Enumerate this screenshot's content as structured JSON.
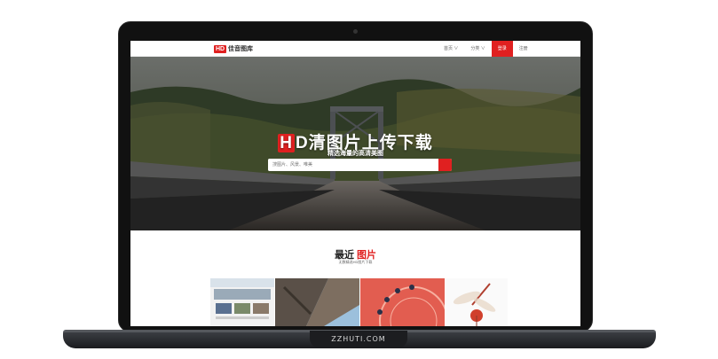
{
  "site": {
    "logo_mark": "HD",
    "logo_text": "佳音图库",
    "nav": [
      "首页 ∨",
      "分类 ∨",
      "登录",
      "注册"
    ]
  },
  "hero": {
    "title_mark": "H",
    "title_rest": "D清图片上传下载",
    "subtitle": "精选海量的高清美图",
    "search_placeholder": "搜图片、风景、唯美"
  },
  "recent": {
    "title_plain": "最近",
    "title_accent": "图片",
    "subtitle": "无数精选HD图片下载"
  },
  "watermark": "ZZHUTI.COM",
  "colors": {
    "accent": "#e02020",
    "bezel": "#111111"
  }
}
